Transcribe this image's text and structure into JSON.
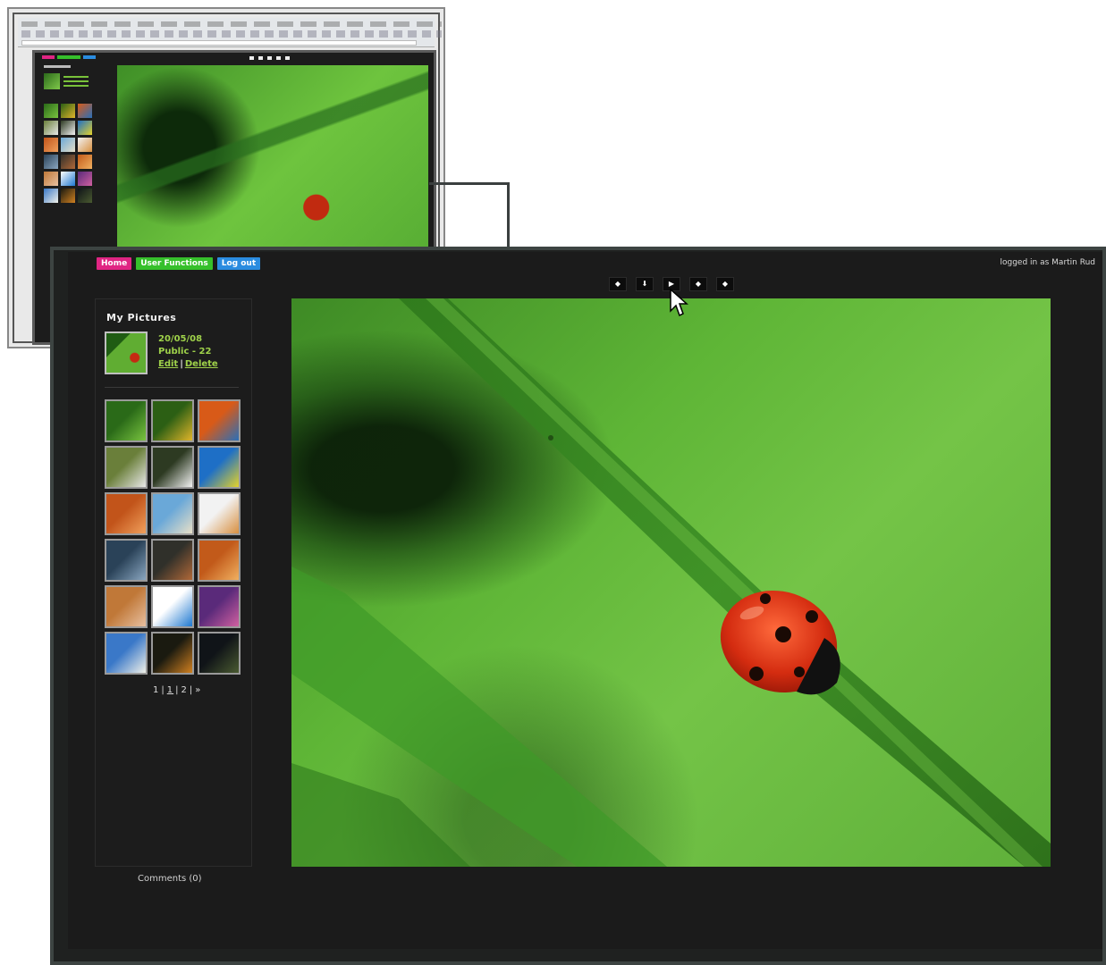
{
  "nav": {
    "home": "Home",
    "user_functions": "User Functions",
    "logout": "Log out"
  },
  "login_status": "logged in as Martin Rud",
  "viewer_controls": [
    {
      "icon": "first-icon",
      "glyph": "◆"
    },
    {
      "icon": "download-icon",
      "glyph": "⬇"
    },
    {
      "icon": "next-icon",
      "glyph": "▶"
    },
    {
      "icon": "slideshow-icon",
      "glyph": "◆"
    },
    {
      "icon": "fullscreen-icon",
      "glyph": "◆"
    }
  ],
  "sidebar": {
    "title": "My Pictures",
    "current": {
      "date": "20/05/08",
      "visibility": "Public - 22",
      "edit_label": "Edit",
      "delete_label": "Delete"
    },
    "pager": {
      "prev": "1",
      "current": "1",
      "next_page": "2",
      "next": "»"
    },
    "thumbnails": [
      {
        "name": "ladybug-leaf",
        "colors": [
          "#2a6a18",
          "#79c33f"
        ]
      },
      {
        "name": "green-yellow",
        "colors": [
          "#2c5f14",
          "#e0b52a"
        ]
      },
      {
        "name": "orange-flower",
        "colors": [
          "#d85a18",
          "#2a6fb8"
        ]
      },
      {
        "name": "golf-ball",
        "colors": [
          "#6a7f3a",
          "#e8e8e8"
        ]
      },
      {
        "name": "white-flower",
        "colors": [
          "#2d3a22",
          "#f2f2f2"
        ]
      },
      {
        "name": "blue-fish",
        "colors": [
          "#1e6fc6",
          "#e4d22a"
        ]
      },
      {
        "name": "basketball",
        "colors": [
          "#c2541a",
          "#f0a05c"
        ]
      },
      {
        "name": "beach",
        "colors": [
          "#6aa8d8",
          "#e8e0c8"
        ]
      },
      {
        "name": "sunglasses",
        "colors": [
          "#f2f2f2",
          "#d89040"
        ]
      },
      {
        "name": "city-street",
        "colors": [
          "#2a4258",
          "#8aa6c0"
        ]
      },
      {
        "name": "motorcycle",
        "colors": [
          "#30302a",
          "#b06838"
        ]
      },
      {
        "name": "sunset-beach",
        "colors": [
          "#c25a1a",
          "#f0b060"
        ]
      },
      {
        "name": "hands",
        "colors": [
          "#c07838",
          "#e8c0a0"
        ]
      },
      {
        "name": "butterfly",
        "colors": [
          "#ffffff",
          "#1e78d0"
        ]
      },
      {
        "name": "purple-palm",
        "colors": [
          "#5a2a7a",
          "#d060a0"
        ]
      },
      {
        "name": "palm-beach",
        "colors": [
          "#3a78c8",
          "#f0f0e8"
        ]
      },
      {
        "name": "cyclist",
        "colors": [
          "#1a1a10",
          "#d08020"
        ]
      },
      {
        "name": "dark-road",
        "colors": [
          "#101418",
          "#4a5a30"
        ]
      }
    ]
  },
  "comments_label": "Comments (0)",
  "colors": {
    "home": "#e02583",
    "user_functions": "#36c02b",
    "logout": "#2a8ce0",
    "meta_text": "#9fd24a",
    "background": "#1b1b1b"
  }
}
